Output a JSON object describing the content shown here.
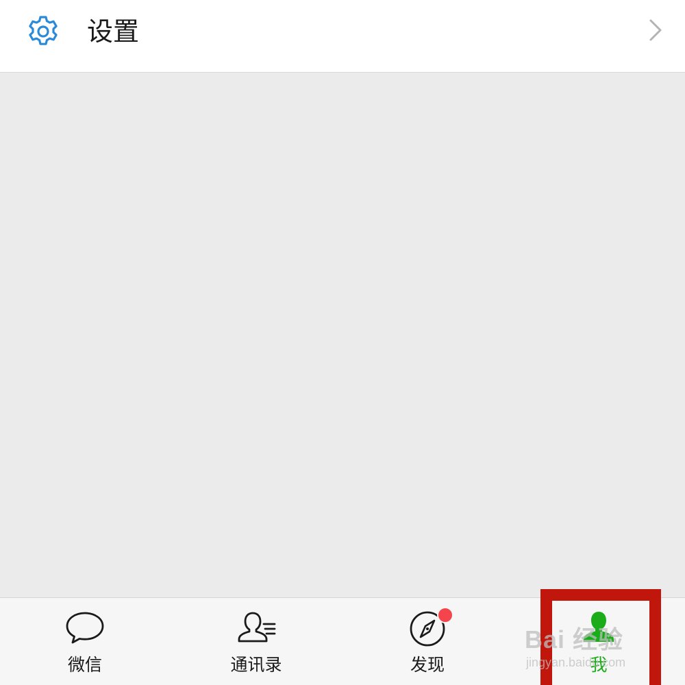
{
  "settings": {
    "label": "设置",
    "icon": "gear-icon",
    "accent": "#2b8ad8"
  },
  "tabs": [
    {
      "label": "微信",
      "icon": "chat-bubble-icon",
      "active": false
    },
    {
      "label": "通讯录",
      "icon": "contacts-icon",
      "active": false
    },
    {
      "label": "发现",
      "icon": "compass-icon",
      "active": false,
      "badge": true
    },
    {
      "label": "我",
      "icon": "person-icon",
      "active": true
    }
  ],
  "colors": {
    "active_tab": "#1aad19",
    "badge": "#f4444c",
    "highlight_frame": "#c0160c"
  },
  "watermark": {
    "main": "Bai 经验",
    "sub": "jingyan.baidu.com"
  }
}
